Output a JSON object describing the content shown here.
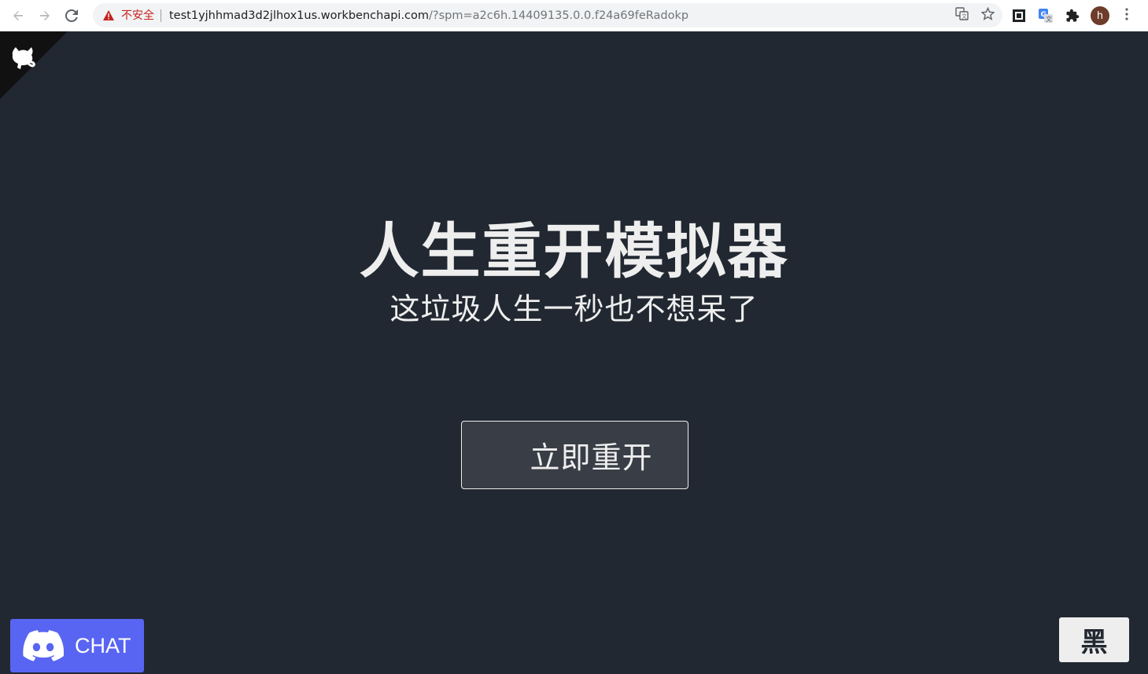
{
  "browser": {
    "security_label": "不安全",
    "url_host": "test1yjhhmad3d2jlhox1us.workbenchapi.com",
    "url_path": "/?spm=a2c6h.14409135.0.0.f24a69feRadokp",
    "avatar_letter": "h"
  },
  "page": {
    "title": "人生重开模拟器",
    "subtitle": "这垃圾人生一秒也不想呆了",
    "restart_button": "立即重开",
    "chat_button": "CHAT",
    "theme_button": "黑"
  },
  "colors": {
    "background": "#222831",
    "button_bg": "#393e46",
    "text": "#eeeeee",
    "discord": "#5865f2",
    "warning": "#c5221f"
  },
  "icons": {
    "corner": "github-octocat-icon",
    "chat": "discord-icon"
  }
}
